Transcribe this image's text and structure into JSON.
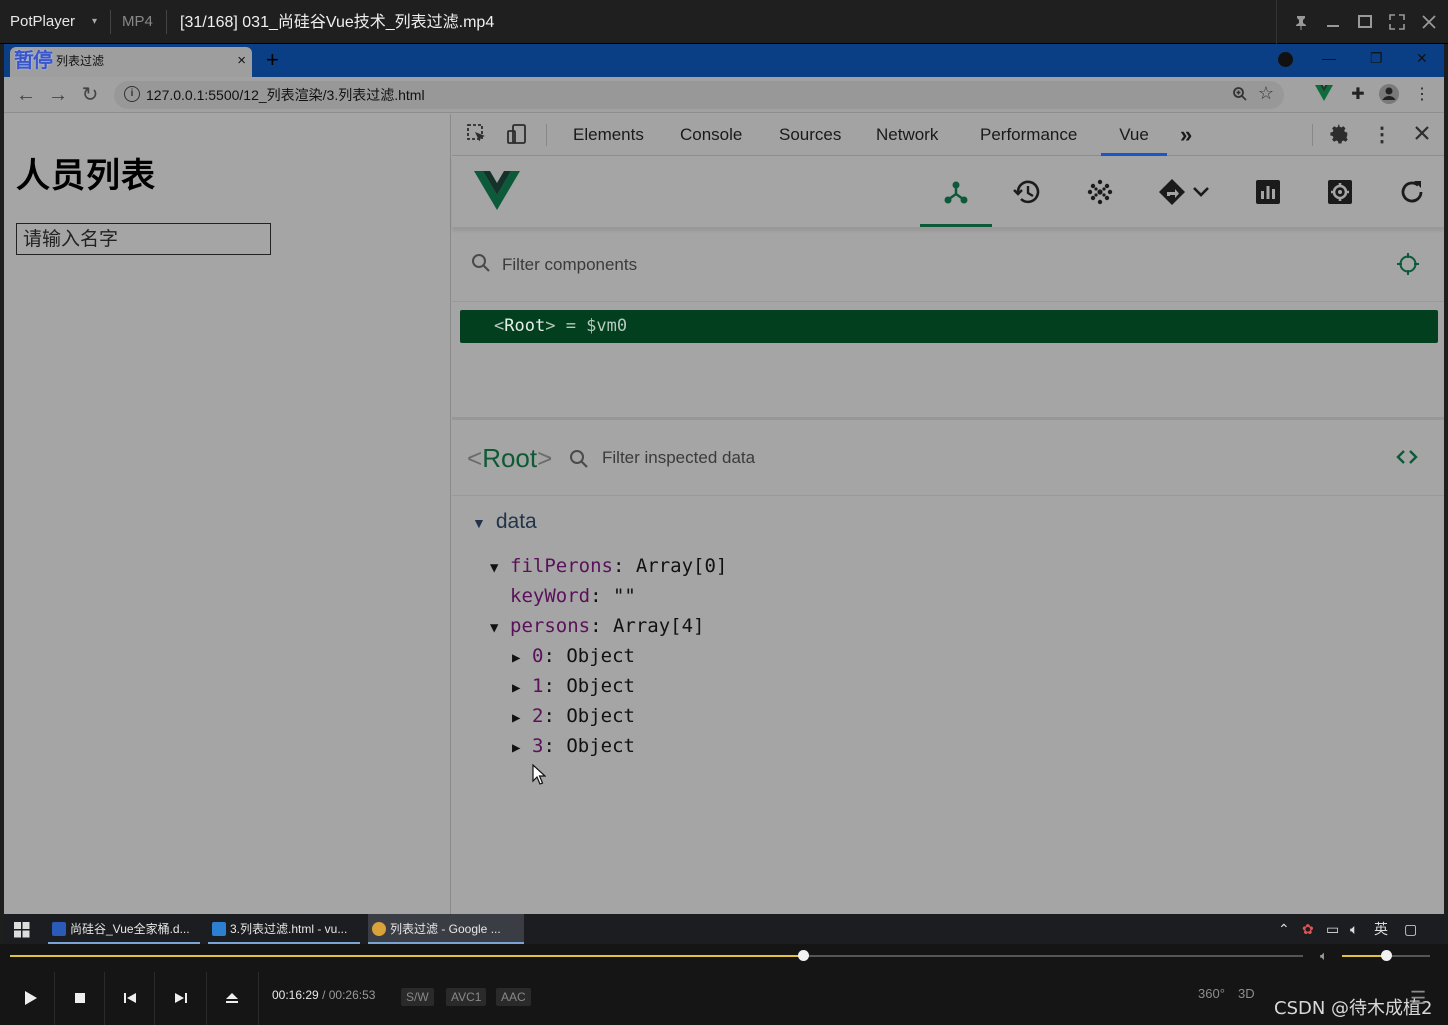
{
  "player": {
    "app_name": "PotPlayer",
    "format": "MP4",
    "video_title": "[31/168] 031_尚硅谷Vue技术_列表过滤.mp4",
    "time_current": "00:16:29",
    "time_separator": "/",
    "time_total": "00:26:53",
    "tags": [
      "S/W",
      "AVC1",
      "AAC"
    ],
    "progress": 0.613,
    "volume": 0.5,
    "right_icons": [
      "360°",
      "3D"
    ],
    "watermark": "CSDN @待木成植2"
  },
  "browser": {
    "pause_overlay": "暂停",
    "tab_title": "列表过滤",
    "tab_close": "×",
    "new_tab": "+",
    "url": "127.0.0.1:5500/12_列表渲染/3.列表过滤.html"
  },
  "page": {
    "heading": "人员列表",
    "search_placeholder": "请输入名字"
  },
  "devtools": {
    "tabs": [
      "Elements",
      "Console",
      "Sources",
      "Network",
      "Performance",
      "Vue"
    ],
    "more": "»",
    "filter_components_placeholder": "Filter components",
    "tree_row": {
      "open": "<",
      "name": "Root",
      "close": ">",
      "assign": " = $vm0"
    },
    "inspector": {
      "open": "<",
      "name": "Root",
      "close": ">",
      "filter_placeholder": "Filter inspected data",
      "section": "data",
      "props": [
        {
          "key": "filPerons",
          "value": "Array[0]",
          "expanded": true
        },
        {
          "key": "keyWord",
          "value": "\"\""
        },
        {
          "key": "persons",
          "value": "Array[4]",
          "expanded": true
        }
      ],
      "items": [
        {
          "key": "0",
          "value": "Object"
        },
        {
          "key": "1",
          "value": "Object"
        },
        {
          "key": "2",
          "value": "Object"
        },
        {
          "key": "3",
          "value": "Object"
        }
      ]
    }
  },
  "taskbar": {
    "tasks": [
      {
        "label": "尚硅谷_Vue全家桶.d...",
        "icon_color": "#2b5bb8"
      },
      {
        "label": "3.列表过滤.html - vu...",
        "icon_color": "#2d7fd1"
      },
      {
        "label": "列表过滤 - Google ...",
        "icon_color": "#d9a23a"
      }
    ],
    "ime": "英"
  },
  "colors": {
    "vue_green": "#0c5a3a",
    "selected_row": "#023f1f",
    "seek_accent": "#e2c33b",
    "devtools_tab_underline": "#1a56c8"
  }
}
